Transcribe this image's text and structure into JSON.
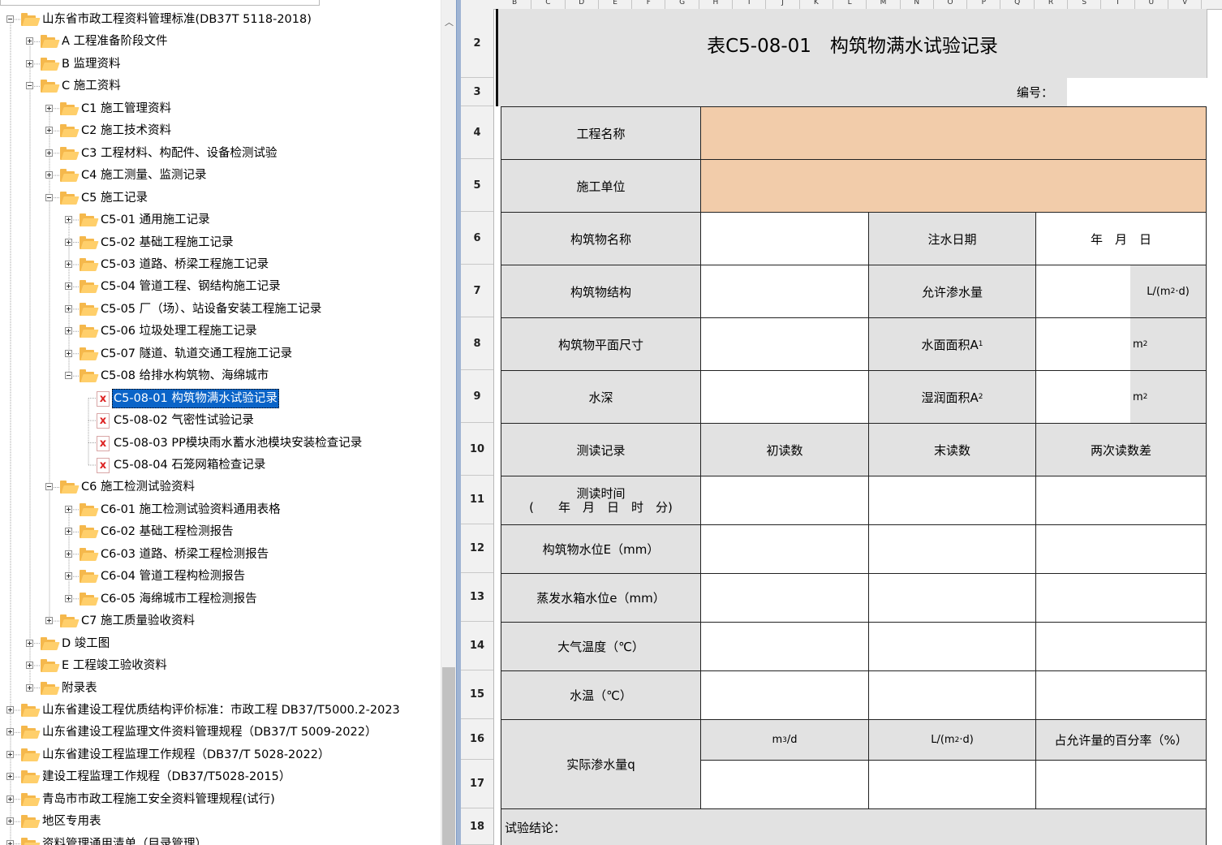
{
  "tree": {
    "nodes": [
      {
        "label": "山东省市政工程资料管理标准(DB37T 5118-2018)",
        "level": 0,
        "exp": "minus"
      },
      {
        "label": "A 工程准备阶段文件",
        "level": 1,
        "exp": "plus"
      },
      {
        "label": "B 监理资料",
        "level": 1,
        "exp": "plus"
      },
      {
        "label": "C 施工资料",
        "level": 1,
        "exp": "minus"
      },
      {
        "label": "C1 施工管理资料",
        "level": 2,
        "exp": "plus"
      },
      {
        "label": "C2 施工技术资料",
        "level": 2,
        "exp": "plus"
      },
      {
        "label": "C3 工程材料、构配件、设备检测试验",
        "level": 2,
        "exp": "plus"
      },
      {
        "label": "C4 施工测量、监测记录",
        "level": 2,
        "exp": "plus"
      },
      {
        "label": "C5 施工记录",
        "level": 2,
        "exp": "minus"
      },
      {
        "label": "C5-01 通用施工记录",
        "level": 3,
        "exp": "plus"
      },
      {
        "label": "C5-02 基础工程施工记录",
        "level": 3,
        "exp": "plus"
      },
      {
        "label": "C5-03 道路、桥梁工程施工记录",
        "level": 3,
        "exp": "plus"
      },
      {
        "label": "C5-04 管道工程、钢结构施工记录",
        "level": 3,
        "exp": "plus"
      },
      {
        "label": "C5-05 厂（场）、站设备安装工程施工记录",
        "level": 3,
        "exp": "plus"
      },
      {
        "label": "C5-06 垃圾处理工程施工记录",
        "level": 3,
        "exp": "plus"
      },
      {
        "label": "C5-07 隧道、轨道交通工程施工记录",
        "level": 3,
        "exp": "plus"
      },
      {
        "label": "C5-08 给排水构筑物、海绵城市",
        "level": 3,
        "exp": "minus"
      },
      {
        "label": "C5-08-01 构筑物满水试验记录",
        "level": 4,
        "file": true,
        "selected": true
      },
      {
        "label": "C5-08-02 气密性试验记录",
        "level": 4,
        "file": true
      },
      {
        "label": "C5-08-03 PP模块雨水蓄水池模块安装检查记录",
        "level": 4,
        "file": true
      },
      {
        "label": "C5-08-04 石笼网箱检查记录",
        "level": 4,
        "file": true
      },
      {
        "label": "C6 施工检测试验资料",
        "level": 2,
        "exp": "minus"
      },
      {
        "label": "C6-01 施工检测试验资料通用表格",
        "level": 3,
        "exp": "plus"
      },
      {
        "label": "C6-02 基础工程检测报告",
        "level": 3,
        "exp": "plus"
      },
      {
        "label": "C6-03 道路、桥梁工程检测报告",
        "level": 3,
        "exp": "plus"
      },
      {
        "label": "C6-04 管道工程构检测报告",
        "level": 3,
        "exp": "plus"
      },
      {
        "label": "C6-05 海绵城市工程检测报告",
        "level": 3,
        "exp": "plus"
      },
      {
        "label": "C7 施工质量验收资料",
        "level": 2,
        "exp": "plus"
      },
      {
        "label": "D 竣工图",
        "level": 1,
        "exp": "plus"
      },
      {
        "label": "E 工程竣工验收资料",
        "level": 1,
        "exp": "plus"
      },
      {
        "label": "附录表",
        "level": 1,
        "exp": "plus"
      },
      {
        "label": "山东省建设工程优质结构评价标准：市政工程 DB37/T5000.2-2023",
        "level": 0,
        "exp": "plus"
      },
      {
        "label": "山东省建设工程监理文件资料管理规程（DB37/T 5009-2022）",
        "level": 0,
        "exp": "plus"
      },
      {
        "label": "山东省建设工程监理工作规程（DB37/T 5028-2022）",
        "level": 0,
        "exp": "plus"
      },
      {
        "label": "建设工程监理工作规程（DB37/T5028-2015）",
        "level": 0,
        "exp": "plus"
      },
      {
        "label": "青岛市市政工程施工安全资料管理规程(试行)",
        "level": 0,
        "exp": "plus"
      },
      {
        "label": "地区专用表",
        "level": 0,
        "exp": "plus"
      },
      {
        "label": "资料管理通用清单（目录管理）",
        "level": 0,
        "exp": "plus"
      }
    ]
  },
  "sheet": {
    "columns": [
      "B",
      "C",
      "D",
      "E",
      "F",
      "G",
      "H",
      "I",
      "J",
      "K",
      "L",
      "M",
      "N",
      "O",
      "P",
      "Q",
      "R",
      "S",
      "T",
      "U",
      "V"
    ],
    "rows": [
      "2",
      "3",
      "4",
      "5",
      "6",
      "7",
      "8",
      "9",
      "10",
      "11",
      "12",
      "13",
      "14",
      "15",
      "16",
      "17",
      "18"
    ],
    "title": "表C5-08-01　构筑物满水试验记录",
    "serial_label": "编号：",
    "labels": {
      "project_name": "工程名称",
      "construction_unit": "施工单位",
      "structure_name": "构筑物名称",
      "fill_date": "注水日期",
      "date_format": "年　月　日",
      "structure_type": "构筑物结构",
      "allowed_seepage": "允许渗水量",
      "plan_size": "构筑物平面尺寸",
      "water_area": "水面面积A",
      "water_area_sub": "1",
      "depth": "水深",
      "wet_area": "湿润面积A",
      "wet_area_sub": "2",
      "unit_m2": "m",
      "unit_sq": "2",
      "unit_L": "L/(m",
      "unit_L_tail": "·d)",
      "reading_record": "测读记录",
      "initial_reading": "初读数",
      "final_reading": "末读数",
      "reading_diff": "两次读数差",
      "reading_time_1": "测读时间",
      "reading_time_2": "(　　年　月　日　时　分)",
      "water_level": "构筑物水位E（mm）",
      "evap_level": "蒸发水箱水位e（mm）",
      "air_temp": "大气温度（℃）",
      "water_temp": "水温（℃）",
      "actual_seepage": "实际渗水量q",
      "m3d": "m",
      "m3d_sup": "3",
      "m3d_tail": "/d",
      "percent": "占允许量的百分率（%）",
      "conclusion": "试验结论："
    },
    "colors": {
      "peach": "#f2ccaa",
      "gray": "#e2e2e2",
      "selection": "#0a64c8",
      "folder": "#ffcf6b"
    }
  }
}
